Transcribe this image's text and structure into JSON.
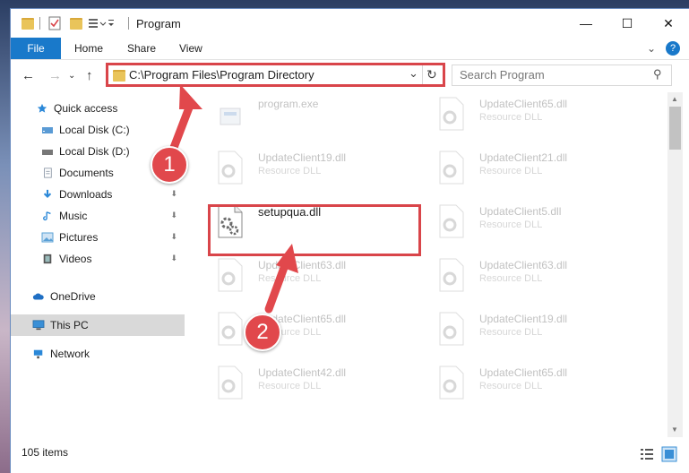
{
  "window": {
    "title": "Program",
    "controls": {
      "minimize": "—",
      "maximize": "☐",
      "close": "✕"
    }
  },
  "ribbon": {
    "tabs": [
      "File",
      "Home",
      "Share",
      "View"
    ],
    "expand": "⌄",
    "help": "?"
  },
  "nav": {
    "back": "←",
    "forward": "→",
    "recent": "⌄",
    "up": "↑",
    "address": "C:\\Program Files\\Program Directory",
    "address_dropdown": "⌄",
    "refresh": "↻",
    "search_placeholder": "Search Program",
    "search_icon": "⚲"
  },
  "sidebar": {
    "items": [
      {
        "label": "Quick access",
        "icon": "star-icon",
        "color": "#2b88d8"
      },
      {
        "label": "Local Disk (C:)",
        "icon": "drive-icon",
        "color": "#5a9bd5"
      },
      {
        "label": "Local Disk (D:)",
        "icon": "drive-icon",
        "color": "#777777"
      },
      {
        "label": "Documents",
        "icon": "documents-icon",
        "color": "#9aa7b5"
      },
      {
        "label": "Downloads",
        "icon": "downloads-icon",
        "color": "#2b88d8",
        "pinned": true
      },
      {
        "label": "Music",
        "icon": "music-icon",
        "color": "#2b88d8",
        "pinned": true
      },
      {
        "label": "Pictures",
        "icon": "pictures-icon",
        "color": "#5aa0d6",
        "pinned": true
      },
      {
        "label": "Videos",
        "icon": "videos-icon",
        "color": "#555555",
        "pinned": true
      },
      {
        "label": "OneDrive",
        "icon": "cloud-icon",
        "color": "#1f6fc4"
      },
      {
        "label": "This PC",
        "icon": "computer-icon",
        "color": "#3a8fd6",
        "selected": true
      },
      {
        "label": "Network",
        "icon": "network-icon",
        "color": "#2b88d8"
      }
    ],
    "pin_glyph": "📌"
  },
  "files": [
    {
      "name": "program.exe",
      "type": "",
      "faded": true
    },
    {
      "name": "UpdateClient65.dll",
      "type": "Resource DLL",
      "faded": true
    },
    {
      "name": "UpdateClient19.dll",
      "type": "Resource DLL",
      "faded": true
    },
    {
      "name": "UpdateClient21.dll",
      "type": "Resource DLL",
      "faded": true
    },
    {
      "name": "setupqua.dll",
      "type": "",
      "faded": false
    },
    {
      "name": "UpdateClient5.dll",
      "type": "Resource DLL",
      "faded": true
    },
    {
      "name": "UpdateClient63.dll",
      "type": "Resource DLL",
      "faded": true
    },
    {
      "name": "UpdateClient63.dll",
      "type": "Resource DLL",
      "faded": true
    },
    {
      "name": "UpdateClient65.dll",
      "type": "Resource DLL",
      "faded": true
    },
    {
      "name": "UpdateClient19.dll",
      "type": "Resource DLL",
      "faded": true
    },
    {
      "name": "UpdateClient42.dll",
      "type": "Resource DLL",
      "faded": true
    },
    {
      "name": "UpdateClient65.dll",
      "type": "Resource DLL",
      "faded": true
    }
  ],
  "status": {
    "count": "105 items"
  },
  "annotations": {
    "step1": "1",
    "step2": "2",
    "highlight_color": "#d9454a"
  }
}
